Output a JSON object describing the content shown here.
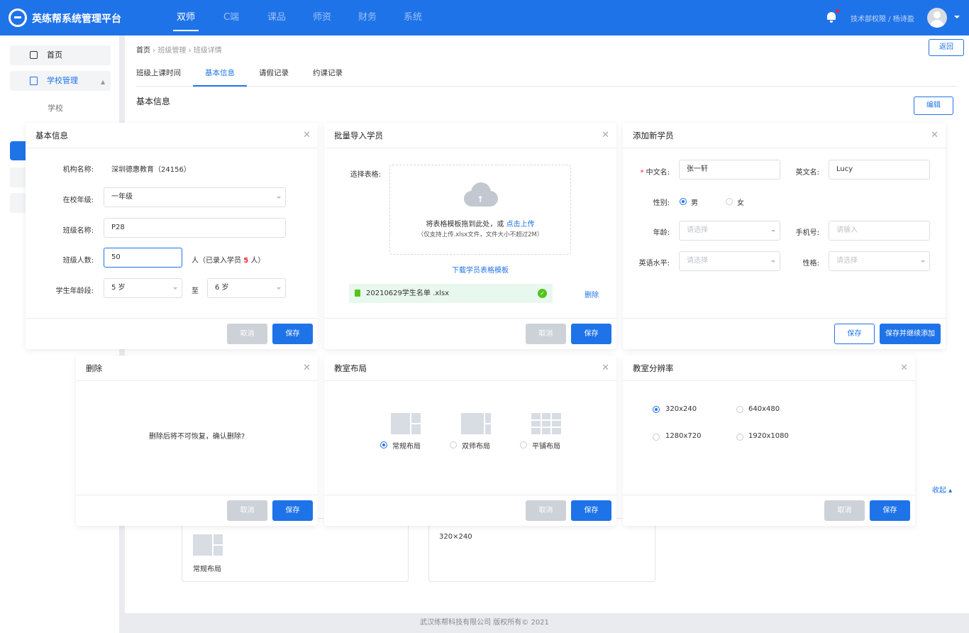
{
  "header": {
    "brand": "英练帮系统管理平台",
    "nav": [
      "双师",
      "C端",
      "课品",
      "师资",
      "财务",
      "系统"
    ],
    "active_nav": "双师",
    "user_path": "技术部权限 / 杨诗盈"
  },
  "sidebar": {
    "home": "首页",
    "school_mgmt": "学校管理",
    "school": "学校"
  },
  "page": {
    "breadcrumb": [
      "首页",
      "班级管理",
      "班级详情"
    ],
    "back": "返回",
    "tabs": [
      "班级上课时间",
      "基本信息",
      "请假记录",
      "约课记录"
    ],
    "active_tab": "基本信息",
    "section_title": "基本信息",
    "edit": "编辑",
    "collapse": "收起",
    "layout_card_label": "常规布局",
    "resolution_card_value": "320×240"
  },
  "footer": "武汉练帮科技有限公司 版权所有© 2021",
  "modals": {
    "basic": {
      "title": "基本信息",
      "org_label": "机构名称:",
      "org_value": "深圳德惠教育（24156）",
      "grade_label": "在校年级:",
      "grade_value": "一年级",
      "class_label": "班级名称:",
      "class_value": "P28",
      "count_label": "班级人数:",
      "count_value": "50",
      "count_suffix_a": "人（已录入学员",
      "count_enrolled": "5",
      "count_suffix_b": "人）",
      "age_label": "学生年龄段:",
      "age_from": "5 岁",
      "age_to_word": "至",
      "age_to": "6 岁",
      "cancel": "取消",
      "save": "保存"
    },
    "import": {
      "title": "批量导入学员",
      "select_label": "选择表格:",
      "drop_text": "将表格模板拖到此处，或",
      "upload_link": "点击上传",
      "drop_hint": "（仅支持上传.xlsx文件，文件大小不超过2M）",
      "download": "下载学员表格模板",
      "file_name": "20210629学生名单 .xlsx",
      "delete": "删除",
      "cancel": "取消",
      "save": "保存"
    },
    "add": {
      "title": "添加新学员",
      "cn_label": "中文名:",
      "cn_value": "张一轩",
      "en_label": "英文名:",
      "en_value": "Lucy",
      "gender_label": "性别:",
      "male": "男",
      "female": "女",
      "age_label": "年龄:",
      "age_placeholder": "请选择",
      "phone_label": "手机号:",
      "phone_placeholder": "请输入",
      "english_label": "英语水平:",
      "english_placeholder": "请选择",
      "character_label": "性格:",
      "character_placeholder": "请选择",
      "save": "保存",
      "save_continue": "保存并继续添加"
    },
    "delete": {
      "title": "删除",
      "message": "删除后将不可恢复，确认删除?",
      "cancel": "取消",
      "save": "保存"
    },
    "layout": {
      "title": "教室布局",
      "options": [
        "常规布局",
        "双师布局",
        "平铺布局"
      ],
      "selected": "常规布局",
      "cancel": "取消",
      "save": "保存"
    },
    "resolution": {
      "title": "教室分辨率",
      "options": [
        "320x240",
        "640x480",
        "1280x720",
        "1920x1080"
      ],
      "selected": "320x240",
      "cancel": "取消",
      "save": "保存"
    }
  },
  "colors": {
    "primary": "#1f73e8",
    "success": "#52c41a",
    "danger": "#f5222d",
    "disabled": "#cdd1d8"
  }
}
